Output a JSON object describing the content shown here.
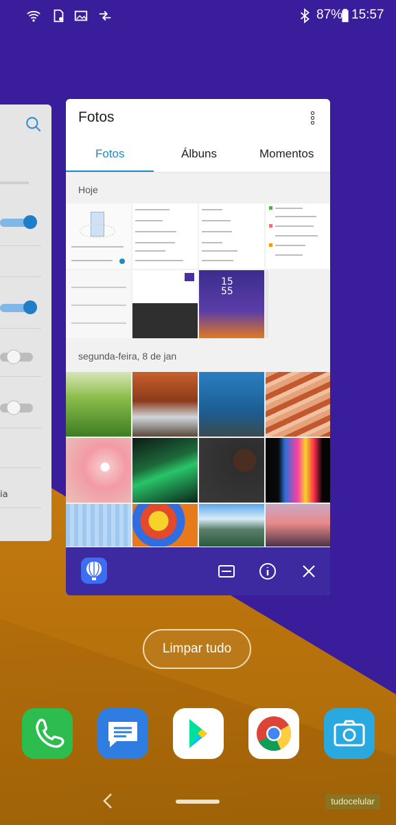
{
  "status_bar": {
    "battery": "87%",
    "time": "15:57"
  },
  "app_card": {
    "title": "Fotos",
    "tabs": [
      {
        "label": "Fotos",
        "selected": true
      },
      {
        "label": "Álbuns"
      },
      {
        "label": "Momentos"
      }
    ],
    "sections": [
      {
        "label": "Hoje"
      },
      {
        "label": "segunda-feira, 8 de jan"
      }
    ]
  },
  "clear_all_label": "Limpar tudo",
  "dock": [
    {
      "name": "phone-icon",
      "color": "#2dbd4e"
    },
    {
      "name": "messages-icon",
      "color": "#2f7de1"
    },
    {
      "name": "play-store-icon",
      "color": "#ffffff"
    },
    {
      "name": "chrome-icon",
      "color": "#ffffff"
    },
    {
      "name": "camera-icon",
      "color": "#29a9e0"
    }
  ],
  "watermark": "tudocelular"
}
